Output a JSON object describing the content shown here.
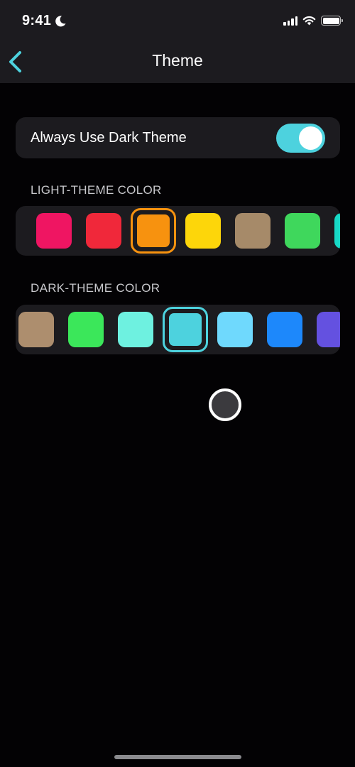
{
  "status_bar": {
    "time": "9:41"
  },
  "nav": {
    "title": "Theme",
    "back_label": "Back"
  },
  "settings": {
    "always_dark": {
      "label": "Always Use Dark Theme",
      "on": true,
      "accent": "#4dd2de"
    }
  },
  "light_theme": {
    "label": "LIGHT-THEME COLOR",
    "colors": [
      "#ef1562",
      "#f0283a",
      "#f7920f",
      "#fdd60a",
      "#a68a69",
      "#3fd75c",
      "#17d9c6"
    ],
    "selected_index": 2
  },
  "dark_theme": {
    "label": "DARK-THEME COLOR",
    "colors": [
      "#ad8e6e",
      "#3be75a",
      "#6ef1e0",
      "#4dd2de",
      "#6fd9fd",
      "#1d88fb",
      "#6451e0"
    ],
    "selected_index": 3
  }
}
